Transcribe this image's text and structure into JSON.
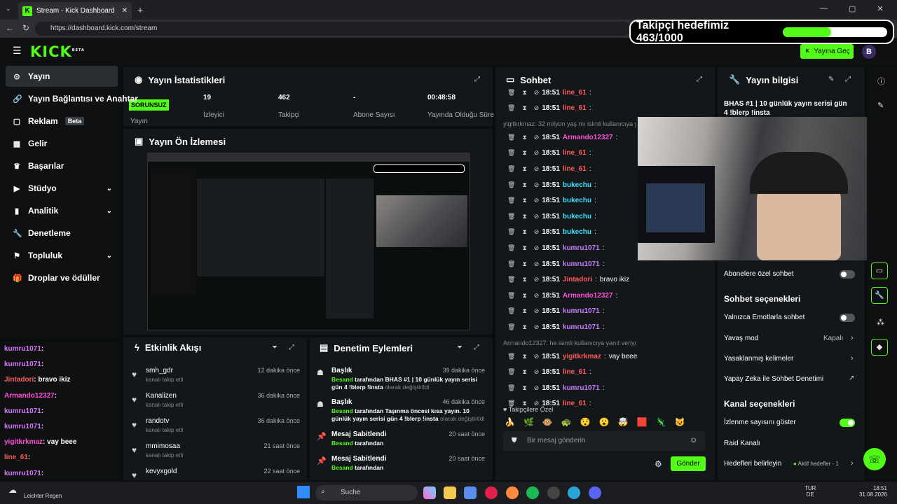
{
  "browser": {
    "tab_title": "Stream - Kick Dashboard",
    "url": "https://dashboard.kick.com/stream"
  },
  "overlay": {
    "goal_text": "Takipçi hedefimiz 463/1000",
    "goal_fraction": 0.463
  },
  "header": {
    "logo": "KICK",
    "logo_badge": "BETA",
    "go_live": "Yayına Geç",
    "avatar_letter": "B"
  },
  "sidebar": {
    "items": [
      {
        "label": "Yayın",
        "icon": "broadcast-icon",
        "active": true
      },
      {
        "label": "Yayın Bağlantısı ve Anahtar"
      },
      {
        "label": "Reklam",
        "badge": "Beta"
      },
      {
        "label": "Gelir"
      },
      {
        "label": "Başarılar"
      },
      {
        "label": "Stüdyo",
        "chevron": true
      },
      {
        "label": "Analitik",
        "chevron": true
      },
      {
        "label": "Denetleme"
      },
      {
        "label": "Topluluk",
        "chevron": true
      },
      {
        "label": "Droplar ve ödüller"
      }
    ]
  },
  "stats": {
    "title": "Yayın İstatistikleri",
    "status_badge": "SORUNSUZ",
    "status_label": "Yayın",
    "viewers_value": "19",
    "viewers_label": "İzleyici",
    "followers_value": "462",
    "followers_label": "Takipçi",
    "subs_value": "-",
    "subs_label": "Abone Sayısı",
    "uptime_value": "00:48:58",
    "uptime_label": "Yayında Olduğu Süre"
  },
  "preview": {
    "title": "Yayın Ön İzlemesi"
  },
  "activity": {
    "title": "Etkinlik Akışı",
    "items": [
      {
        "name": "smh_gdr",
        "sub": "kanalı takip etti",
        "time": "12 dakika önce"
      },
      {
        "name": "Kanalizen",
        "sub": "kanalı takip etti",
        "time": "36 dakika önce"
      },
      {
        "name": "randotv",
        "sub": "kanalı takip etti",
        "time": "36 dakika önce"
      },
      {
        "name": "mmimosaa",
        "sub": "kanalı takip etti",
        "time": "21 saat önce"
      },
      {
        "name": "kevyxgold",
        "sub": "",
        "time": "22 saat önce"
      }
    ]
  },
  "moderation": {
    "title": "Denetim Eylemleri",
    "items": [
      {
        "title": "Başlık",
        "user": "Besand",
        "text": "tarafından BHAS #1 | 10 günlük yayın serisi gün 4 !blerp !insta",
        "suffix": "olarak değiştirildi",
        "time": "39 dakika önce"
      },
      {
        "title": "Başlık",
        "user": "Besand",
        "text": "tarafından Taşınma öncesi kısa yayın. 10 günlük yayın serisi gün 4 !blerp !insta",
        "suffix": "olarak değiştirildi",
        "time": "46 dakika önce"
      },
      {
        "title": "Mesaj Sabitlendi",
        "user": "Besand",
        "text": "tarafından",
        "suffix": "",
        "time": "20 saat önce"
      },
      {
        "title": "Mesaj Sabitlendi",
        "user": "Besand",
        "text": "tarafından",
        "suffix": "",
        "time": "20 saat önce"
      }
    ]
  },
  "chat": {
    "title": "Sohbet",
    "lines": [
      {
        "time": "18:51",
        "user": "line_61",
        "color": "#ff5a5a",
        "msg": ""
      },
      {
        "time": "18:51",
        "user": "line_61",
        "color": "#ff5a5a",
        "msg": ""
      },
      {
        "sys": "yigitkrkmaz: 32 milyon yaş mı isimli kullanıcıya yanıt veriyor"
      },
      {
        "time": "18:51",
        "user": "Armando12327",
        "color": "#ff4fd8",
        "msg": ""
      },
      {
        "time": "18:51",
        "user": "line_61",
        "color": "#ff5a5a",
        "msg": ""
      },
      {
        "time": "18:51",
        "user": "line_61",
        "color": "#ff5a5a",
        "msg": ""
      },
      {
        "time": "18:51",
        "user": "bukechu",
        "color": "#3de0ff",
        "msg": ""
      },
      {
        "time": "18:51",
        "user": "bukechu",
        "color": "#3de0ff",
        "msg": ""
      },
      {
        "time": "18:51",
        "user": "bukechu",
        "color": "#3de0ff",
        "msg": ""
      },
      {
        "time": "18:51",
        "user": "bukechu",
        "color": "#3de0ff",
        "msg": ""
      },
      {
        "time": "18:51",
        "user": "kumru1071",
        "color": "#c77dff",
        "msg": ""
      },
      {
        "time": "18:51",
        "user": "kumru1071",
        "color": "#c77dff",
        "msg": ""
      },
      {
        "time": "18:51",
        "user": "Jintadori",
        "color": "#ff5a5a",
        "msg": "bravo ikiz"
      },
      {
        "time": "18:51",
        "user": "Armando12327",
        "color": "#ff4fd8",
        "msg": ""
      },
      {
        "time": "18:51",
        "user": "kumru1071",
        "color": "#c77dff",
        "msg": ""
      },
      {
        "time": "18:51",
        "user": "kumru1071",
        "color": "#c77dff",
        "msg": ""
      },
      {
        "sys": "Armando12327: he isimli kullanıcıya yanıt veriyor"
      },
      {
        "time": "18:51",
        "user": "yigitkrkmaz",
        "color": "#ff5a5a",
        "msg": "vay beee"
      },
      {
        "time": "18:51",
        "user": "line_61",
        "color": "#ff5a5a",
        "msg": ""
      },
      {
        "time": "18:51",
        "user": "kumru1071",
        "color": "#c77dff",
        "msg": ""
      },
      {
        "time": "18:51",
        "user": "line_61",
        "color": "#ff5a5a",
        "msg": ""
      }
    ],
    "emote_label": "Takipçilere Özel",
    "input_placeholder": "Bir mesaj gönderin",
    "send": "Gönder"
  },
  "info": {
    "title": "Yayın bilgisi",
    "stream_title": "BHAS #1 | 10 günlük yayın serisi gün 4 !blerp !insta",
    "sub_only": "Abonelere özel sohbet",
    "chat_options": "Sohbet seçenekleri",
    "emote_only": "Yalnızca Emotlarla sohbet",
    "slow_mode": "Yavaş mod",
    "slow_value": "Kapalı",
    "banned_words": "Yasaklanmış kelimeler",
    "ai_mod": "Yapay Zeka ile Sohbet Denetimi",
    "channel_options": "Kanal seçenekleri",
    "show_viewers": "İzlenme sayısını göster",
    "raid": "Raid Kanalı",
    "set_goals": "Hedefleri belirleyin",
    "goals_value": "Aktif hedefler - 1"
  },
  "overlay_chat": [
    {
      "user": "kumru1071",
      "color": "#d873ff",
      "msg": ""
    },
    {
      "user": "kumru1071",
      "color": "#d873ff",
      "msg": ""
    },
    {
      "user": "Jintadori",
      "color": "#ff5a5a",
      "msg": "bravo ikiz"
    },
    {
      "user": "Armando12327",
      "color": "#ff4fd8",
      "msg": ""
    },
    {
      "user": "kumru1071",
      "color": "#d873ff",
      "msg": ""
    },
    {
      "user": "kumru1071",
      "color": "#d873ff",
      "msg": ""
    },
    {
      "user": "yigitkrkmaz",
      "color": "#ff4fd8",
      "msg": "vay beee"
    },
    {
      "user": "line_61",
      "color": "#ff5a5a",
      "msg": ""
    },
    {
      "user": "kumru1071",
      "color": "#d873ff",
      "msg": ""
    }
  ],
  "taskbar": {
    "weather": "Leichter Regen",
    "search": "Suche",
    "lang": "TUR",
    "lang2": "DE",
    "time": "18:51",
    "date": "31.08.2026"
  },
  "colors": {
    "accent": "#53fc18",
    "bg": "#0b0e0f",
    "panel": "#141719"
  }
}
